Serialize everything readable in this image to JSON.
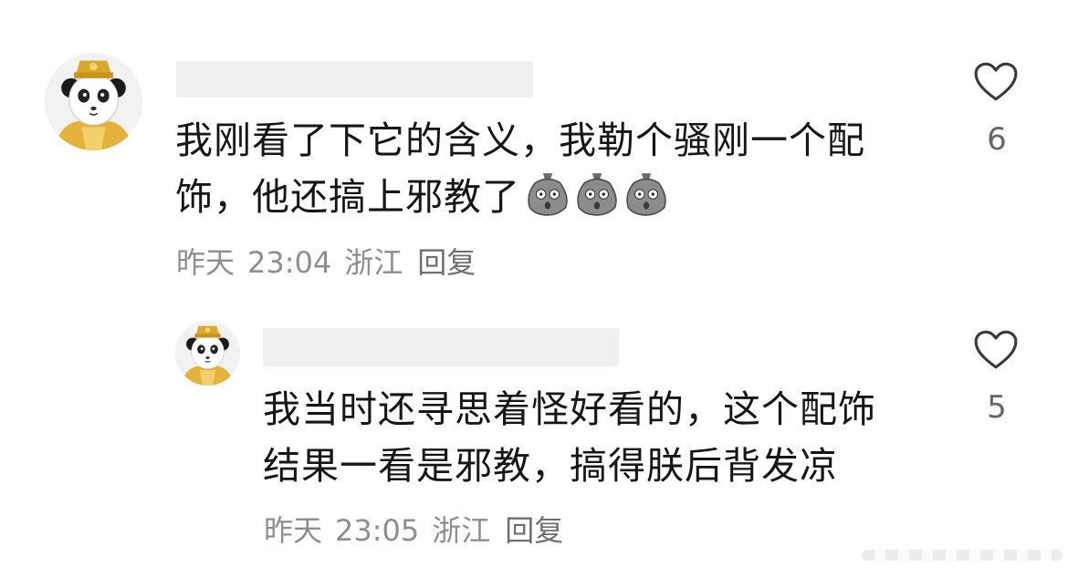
{
  "comments": [
    {
      "text_lines": [
        "我刚看了下它的含义，我勒个骚刚一个配",
        "饰，他还搞上邪教了"
      ],
      "emoji": [
        "shocked-potato-emoji",
        "shocked-potato-emoji",
        "shocked-potato-emoji"
      ],
      "date": "昨天",
      "time": "23:04",
      "location": "浙江",
      "reply_label": "回复",
      "likes": "6"
    },
    {
      "text_lines": [
        "我当时还寻思着怪好看的，这个配饰",
        "结果一看是邪教，搞得朕后背发凉"
      ],
      "date": "昨天",
      "time": "23:05",
      "location": "浙江",
      "reply_label": "回复",
      "likes": "5"
    }
  ],
  "colors": {
    "text": "#161616",
    "meta": "#8e8e8e",
    "like_count": "#666666",
    "avatar_robe": "#e4b23a"
  },
  "icons": {
    "like": "heart-outline-icon",
    "avatar": "panda-emperor-avatar"
  }
}
